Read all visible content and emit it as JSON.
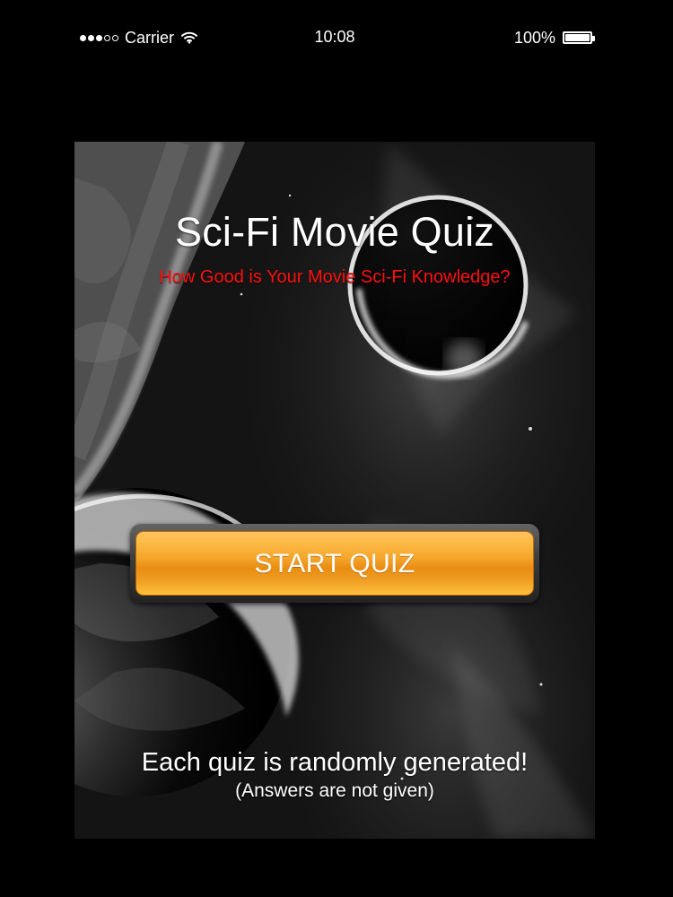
{
  "status_bar": {
    "carrier": "Carrier",
    "time": "10:08",
    "battery_percent": "100%",
    "signal_strength_filled": 3,
    "signal_strength_total": 5,
    "battery_level": 1.0,
    "icons": {
      "signal": "signal-dots-icon",
      "wifi": "wifi-icon",
      "battery": "battery-icon"
    }
  },
  "quiz_screen": {
    "title": "Sci-Fi Movie Quiz",
    "subtitle": "How Good is Your Movie Sci-Fi Knowledge?",
    "start_button_label": "START QUIZ",
    "footer_main": "Each quiz is randomly generated!",
    "footer_sub": "(Answers are not given)"
  },
  "colors": {
    "background": "#000000",
    "title_text": "#ffffff",
    "subtitle_text": "#ff1010",
    "button_orange": "#f5a52b",
    "button_text": "#ffffff"
  }
}
